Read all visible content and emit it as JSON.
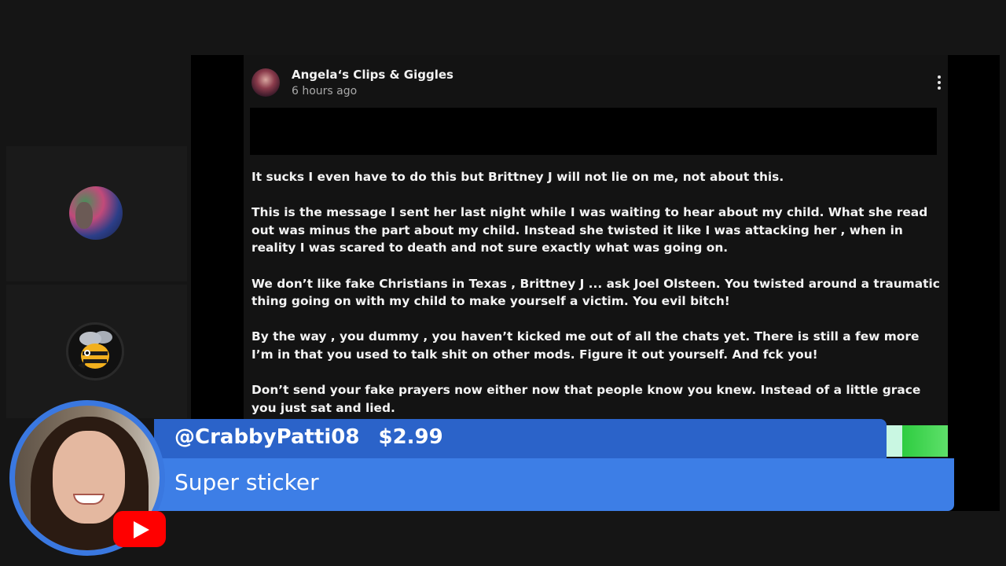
{
  "post": {
    "author": "Angela‘s Clips & Giggles",
    "time": "6 hours ago",
    "paragraphs": [
      "It sucks I even have to do this but Brittney J will not lie on me, not about this.",
      "This is the message I sent her last night while I was waiting to hear about my child. What she read out was minus the part about my child. Instead she twisted it like I was attacking her , when in reality I was scared to death and not sure exactly what was going on.",
      "We don’t like fake Christians in Texas , Brittney J ... ask Joel Olsteen. You twisted around a traumatic thing going on with my child to make yourself a victim. You evil bitch!",
      "By the way , you dummy , you haven’t kicked me out of all the chats yet. There is still a few more I’m in that you used to talk shit on other mods. Figure it out yourself. And fck you!",
      "Don’t send your fake prayers now either now that people know you knew. Instead of a little grace you just sat and lied."
    ]
  },
  "super_chat": {
    "username": "@CrabbyPatti08",
    "amount": "$2.99",
    "message": "Super sticker"
  },
  "icons": {
    "more": "more-vert-icon",
    "youtube": "youtube-logo-icon",
    "bee": "bee-avatar-icon"
  },
  "colors": {
    "superchat_top": "#2b63c9",
    "superchat_bottom": "#3d7ee6",
    "youtube_red": "#ff0000"
  }
}
